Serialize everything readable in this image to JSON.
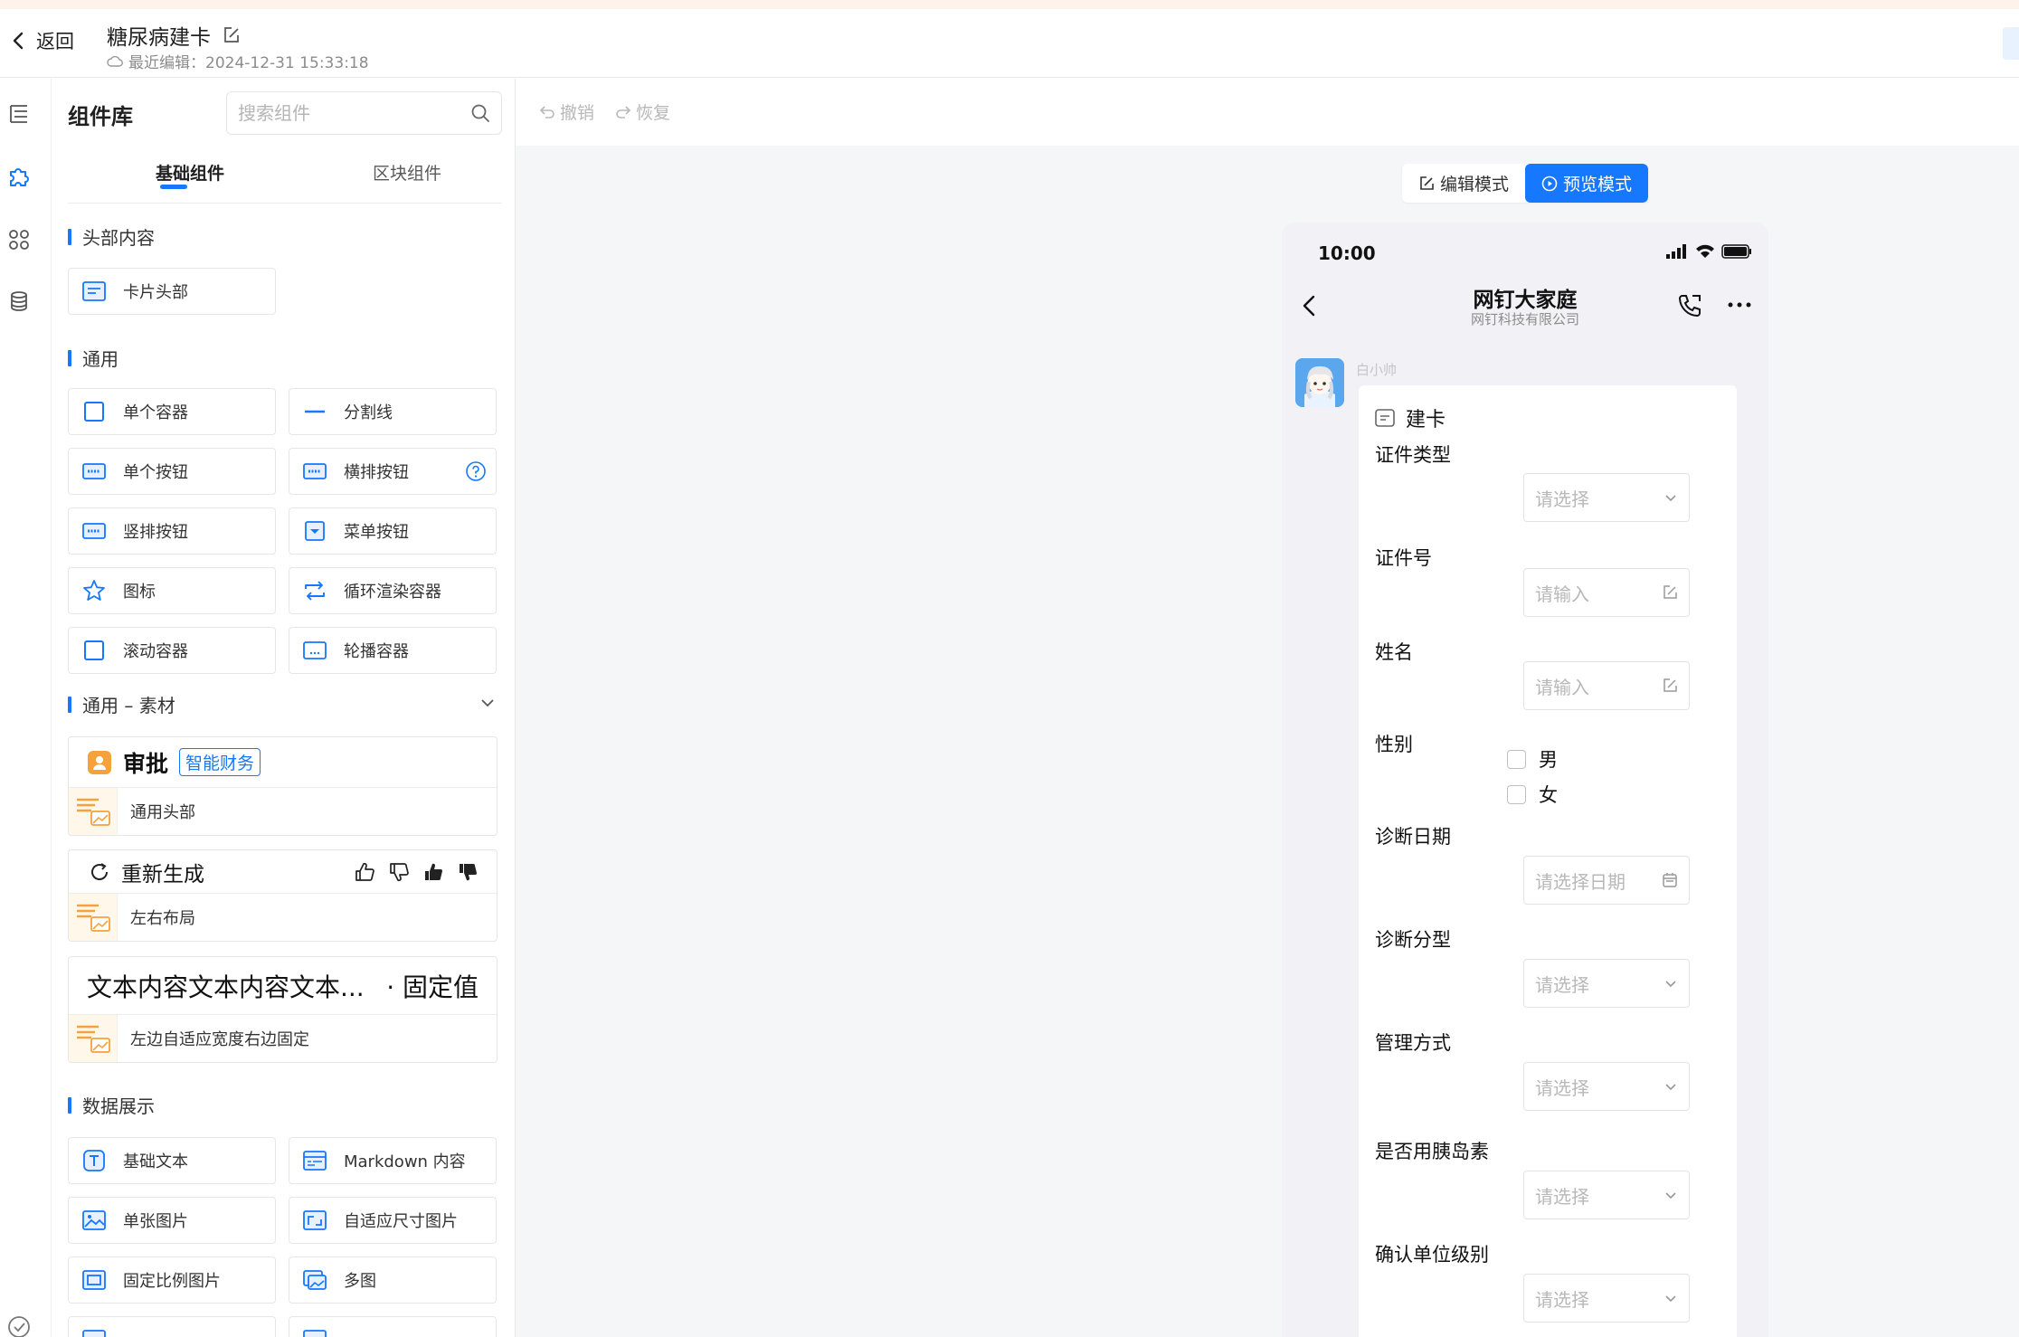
{
  "header": {
    "back_label": "返回",
    "title": "糖尿病建卡",
    "last_edit": "最近编辑：2024-12-31 15:33:18"
  },
  "panel": {
    "title": "组件库",
    "search_placeholder": "搜索组件",
    "tabs": [
      {
        "label": "基础组件",
        "active": true
      },
      {
        "label": "区块组件",
        "active": false
      }
    ],
    "sections": {
      "header_content": {
        "title": "头部内容",
        "items": [
          {
            "label": "卡片头部",
            "icon": "card-header-icon"
          }
        ]
      },
      "general": {
        "title": "通用",
        "items": [
          {
            "label": "单个容器",
            "icon": "container-icon"
          },
          {
            "label": "分割线",
            "icon": "divider-icon"
          },
          {
            "label": "单个按钮",
            "icon": "button-icon"
          },
          {
            "label": "横排按钮",
            "icon": "button-row-icon"
          },
          {
            "label": "竖排按钮",
            "icon": "button-column-icon"
          },
          {
            "label": "菜单按钮",
            "icon": "menu-button-icon"
          },
          {
            "label": "图标",
            "icon": "star-icon"
          },
          {
            "label": "循环渲染容器",
            "icon": "loop-icon"
          },
          {
            "label": "滚动容器",
            "icon": "scroll-container-icon"
          },
          {
            "label": "轮播容器",
            "icon": "carousel-icon"
          }
        ]
      },
      "materials": {
        "title": "通用 – 素材",
        "cards": [
          {
            "preview_title": "审批",
            "preview_tag": "智能财务",
            "label": "通用头部"
          },
          {
            "preview_title": "重新生成",
            "label": "左右布局"
          },
          {
            "preview_text": "文本内容文本内容文本...",
            "preview_fixed": "· 固定值",
            "label": "左边自适应宽度右边固定"
          }
        ]
      },
      "data_display": {
        "title": "数据展示",
        "items": [
          {
            "label": "基础文本",
            "icon": "text-icon"
          },
          {
            "label": "Markdown 内容",
            "icon": "markdown-icon"
          },
          {
            "label": "单张图片",
            "icon": "image-icon"
          },
          {
            "label": "自适应尺寸图片",
            "icon": "adaptive-image-icon"
          },
          {
            "label": "固定比例图片",
            "icon": "fixed-ratio-image-icon"
          },
          {
            "label": "多图",
            "icon": "multi-image-icon"
          }
        ]
      }
    }
  },
  "toolbar": {
    "undo_label": "撤销",
    "redo_label": "恢复"
  },
  "mode": {
    "edit_label": "编辑模式",
    "preview_label": "预览模式",
    "active": "preview"
  },
  "phone": {
    "time": "10:00",
    "chat_title": "网钉大家庭",
    "chat_subtitle": "网钉科技有限公司",
    "sender": "白小帅",
    "card_title": "建卡",
    "fields": [
      {
        "label": "证件类型",
        "type": "select",
        "placeholder": "请选择"
      },
      {
        "label": "证件号",
        "type": "input",
        "placeholder": "请输入"
      },
      {
        "label": "姓名",
        "type": "input",
        "placeholder": "请输入"
      },
      {
        "label": "性别",
        "type": "checkbox",
        "options": [
          "男",
          "女"
        ]
      },
      {
        "label": "诊断日期",
        "type": "date",
        "placeholder": "请选择日期"
      },
      {
        "label": "诊断分型",
        "type": "select",
        "placeholder": "请选择"
      },
      {
        "label": "管理方式",
        "type": "select",
        "placeholder": "请选择"
      },
      {
        "label": "是否用胰岛素",
        "type": "select",
        "placeholder": "请选择"
      },
      {
        "label": "确认单位级别",
        "type": "select",
        "placeholder": "请选择"
      }
    ]
  },
  "colors": {
    "accent": "#1677ff",
    "canvas_bg": "#f5f6f7",
    "material_orange": "#f5a13c"
  }
}
